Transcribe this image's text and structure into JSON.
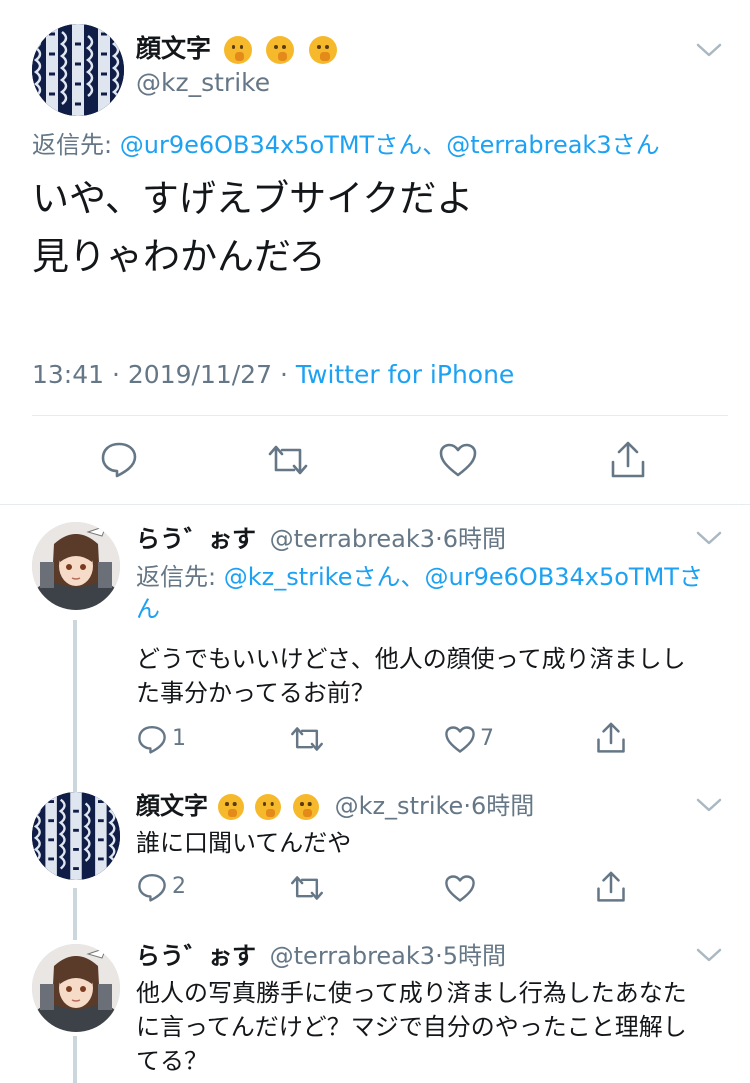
{
  "main_tweet": {
    "author_name": "顔文字",
    "handle": "@kz_strike",
    "reply_prefix": "返信先:",
    "reply_to": "@ur9e6OB34x5oTMTさん、@terrabreak3さん",
    "text_line1": "いや、すげえブサイクだよ",
    "text_line2": "見りゃわかんだろ",
    "time": "13:41",
    "date": "2019/11/27",
    "source": "Twitter for iPhone"
  },
  "replies": [
    {
      "author_name": "らう゛ぉす",
      "handle": "@terrabreak3",
      "time_ago": "6時間",
      "reply_prefix": "返信先:",
      "reply_to_line1": "@kz_strikeさん、@ur9e6OB34x5oTMTさ",
      "reply_to_line2": "ん",
      "text_line1": "どうでもいいけどさ、他人の顔使って成り済ましし",
      "text_line2": "た事分かってるお前？",
      "reply_count": "1",
      "like_count": "7"
    },
    {
      "author_name": "顔文字",
      "handle": "@kz_strike",
      "time_ago": "6時間",
      "text_line1": "誰に口聞いてんだや",
      "reply_count": "2"
    },
    {
      "author_name": "らう゛ぉす",
      "handle": "@terrabreak3",
      "time_ago": "5時間",
      "text_line1": "他人の写真勝手に使って成り済まし行為したあなた",
      "text_line2": "に言ってんだけど？マジで自分のやったこと理解し",
      "text_line3": "てる？"
    }
  ],
  "icons": {
    "emoji": "hand-over-mouth-emoji",
    "chevron": "chevron-down-icon",
    "reply": "reply-icon",
    "retweet": "retweet-icon",
    "like": "like-icon",
    "share": "share-icon"
  },
  "colors": {
    "link": "#1da1f2",
    "muted": "#657786",
    "icon": "#657786",
    "divider": "#e6ecf0"
  },
  "separator": "·"
}
